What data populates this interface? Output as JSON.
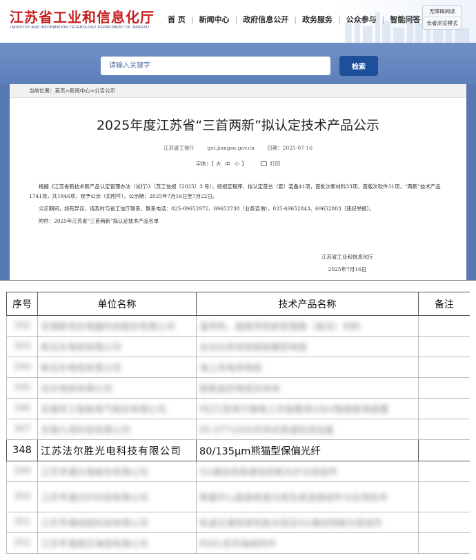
{
  "header": {
    "logo_cn": "江苏省工业和信息化厅",
    "logo_en": "INDUSTRY AND INFORMATION TECHNOLOGY DEPARTMENT OF JIANGSU",
    "nav": [
      "首 页",
      "新闻中心",
      "政府信息公开",
      "政务服务",
      "公众参与",
      "智能问答"
    ],
    "accessibility": [
      "无障碍阅读",
      "长者浏览模式"
    ]
  },
  "search": {
    "placeholder": "请输入关键字",
    "button": "检索"
  },
  "breadcrumb": "当前位置：首页>新闻中心>公告公示",
  "article": {
    "title": "2025年度江苏省“三首两新”拟认定技术产品公示",
    "source": "江苏省工信厅",
    "site": "gxt.jiangsu.gov.cn",
    "date": "日期：2025-07-16",
    "font_label": "字体：【",
    "font_sizes": [
      "大",
      "中",
      "小"
    ],
    "font_close": "】",
    "print": "打印",
    "paragraphs": [
      "根据《江苏省新技术新产品认定管理办法（试行）》（苏工信规〔2025〕3 号），经规定程序，拟认定首台（套）装备41项，首批次新材料33项，首版次软件31项，“两新”技术产品1741项，共1846项，现予公示（见附件）。公示期：2025年7月16日至7月22日。",
      "公示期间，如有异议，请及时与省工信厅联系，联系电话：025-69652972、69652738（业务咨询），025-69652843、69652803（违纪举报）。",
      "附件：2025年江苏省“三首两新”拟认定技术产品名单"
    ],
    "signature": "江苏省工业和信息化厅",
    "signature_date": "2025年7月16日"
  },
  "table": {
    "headers": [
      "序号",
      "单位名称",
      "技术产品名称",
      "备注"
    ],
    "rows": [
      {
        "no": "342",
        "unit": "无锡新世纪电器科技股份有限公司",
        "product": "温导热、超高导热新型管路（板坯）材料",
        "note": "",
        "blurred": true
      },
      {
        "no": "343",
        "unit": "新远东电缆有限公司",
        "product": "全动光系统用高耐磨损电缆",
        "note": "",
        "blurred": true
      },
      {
        "no": "344",
        "unit": "新远东电缆有限公司",
        "product": "海上风电用电缆",
        "note": "",
        "blurred": true
      },
      {
        "no": "345",
        "unit": "远东电缆有限公司",
        "product": "智能监控电缆及系统",
        "note": "",
        "blurred": true
      },
      {
        "no": "346",
        "unit": "无锡军工智能电气股份有限公司",
        "product": "PEZ1型用于输电工作装置用10kV智能配电装置",
        "note": "",
        "blurred": true
      },
      {
        "no": "347",
        "unit": "无锡九茂科技有限公司",
        "product": "95-VTT1000手持式高速检测设备",
        "note": "",
        "blurred": true
      },
      {
        "no": "348",
        "unit": "江苏法尔胜光电科技有限公司",
        "product": "80/135μm熊猫型保偏光纤",
        "note": "",
        "blurred": false
      },
      {
        "no": "349",
        "unit": "江苏亨通光电股份有限公司",
        "product": "5G通信用高速低损耗光纤光缆组件",
        "note": "",
        "blurred": true
      },
      {
        "no": "350",
        "unit": "江苏亨通光纤科技有限公司",
        "product": "数据中心超高密度光缆及其连接组件与应用技术",
        "note": "",
        "blurred": true,
        "tall": true
      },
      {
        "no": "351",
        "unit": "江苏亨通线缆科技有限公司",
        "product": "轨道交通用高性能光缆及5G通信网络光缆组件",
        "note": "",
        "blurred": true
      },
      {
        "no": "352",
        "unit": "江苏亨通高压海缆有限公司",
        "product": "RS91系列海缆附件",
        "note": "",
        "blurred": true
      }
    ]
  },
  "colors": {
    "brand_red": "#c61e1e",
    "brand_blue": "#1d4f9a",
    "band_blue": "#5878b0"
  }
}
